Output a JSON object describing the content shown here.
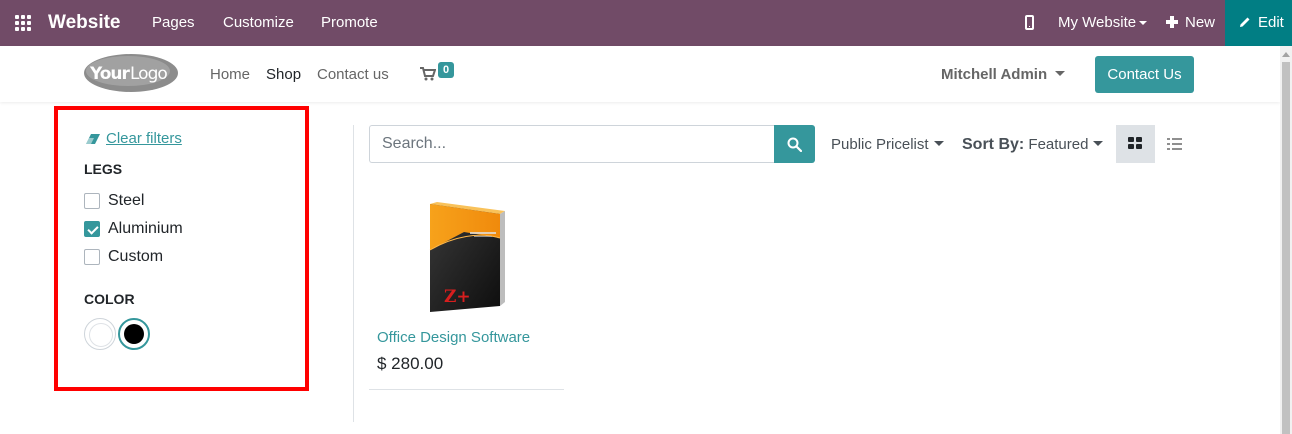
{
  "topbar": {
    "app_name": "Website",
    "menu": [
      "Pages",
      "Customize",
      "Promote"
    ],
    "website_selector": "My Website",
    "new_label": "New",
    "edit_label": "Edit",
    "colors": {
      "bar": "#714b67",
      "edit": "#017e84"
    }
  },
  "header": {
    "logo_text": "YourLogo",
    "nav": [
      "Home",
      "Shop",
      "Contact us"
    ],
    "active_nav": "Shop",
    "cart_count": "0",
    "user_name": "Mitchell Admin",
    "contact_button": "Contact Us",
    "accent": "#35979c"
  },
  "filters": {
    "clear_label": "Clear filters",
    "legs": {
      "title": "LEGS",
      "options": [
        {
          "label": "Steel",
          "checked": false
        },
        {
          "label": "Aluminium",
          "checked": true
        },
        {
          "label": "Custom",
          "checked": false
        }
      ]
    },
    "color": {
      "title": "COLOR",
      "swatches": [
        {
          "name": "White",
          "hex": "#ffffff",
          "selected": false
        },
        {
          "name": "Black",
          "hex": "#000000",
          "selected": true
        }
      ]
    },
    "highlight_color": "#ff0000"
  },
  "toolbar": {
    "search_placeholder": "Search...",
    "pricelist": "Public Pricelist",
    "sort_label": "Sort By:",
    "sort_value": "Featured",
    "view_mode": "grid"
  },
  "products": [
    {
      "name": "Office Design Software",
      "price": "$ 280.00",
      "box_label": "Z+"
    }
  ]
}
